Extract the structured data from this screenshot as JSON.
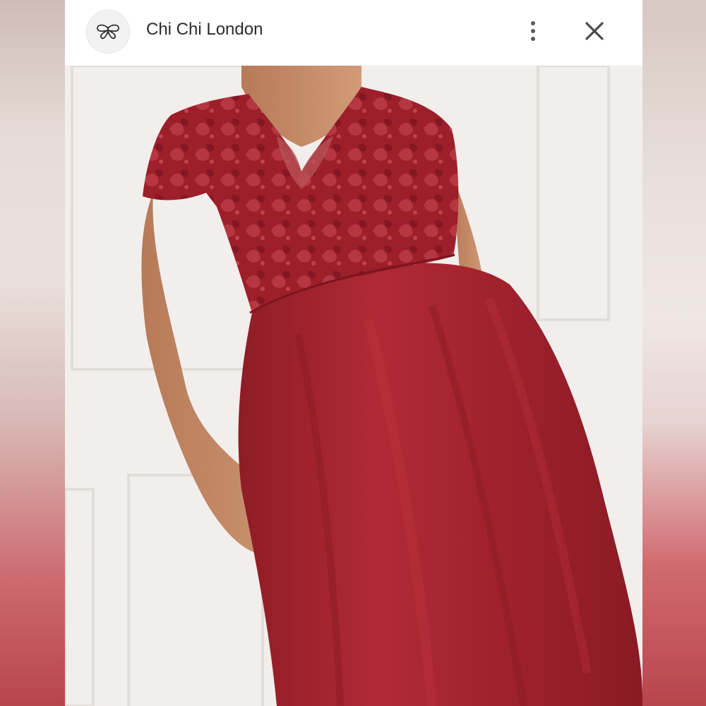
{
  "header": {
    "title": "Chi Chi London",
    "avatar_icon": "butterfly-logo-icon",
    "menu_icon": "more-vertical-icon",
    "close_icon": "close-icon"
  },
  "photo": {
    "subject": "product-photo",
    "dress_color": "#a8242f",
    "wall_color": "#f1eeeb"
  }
}
